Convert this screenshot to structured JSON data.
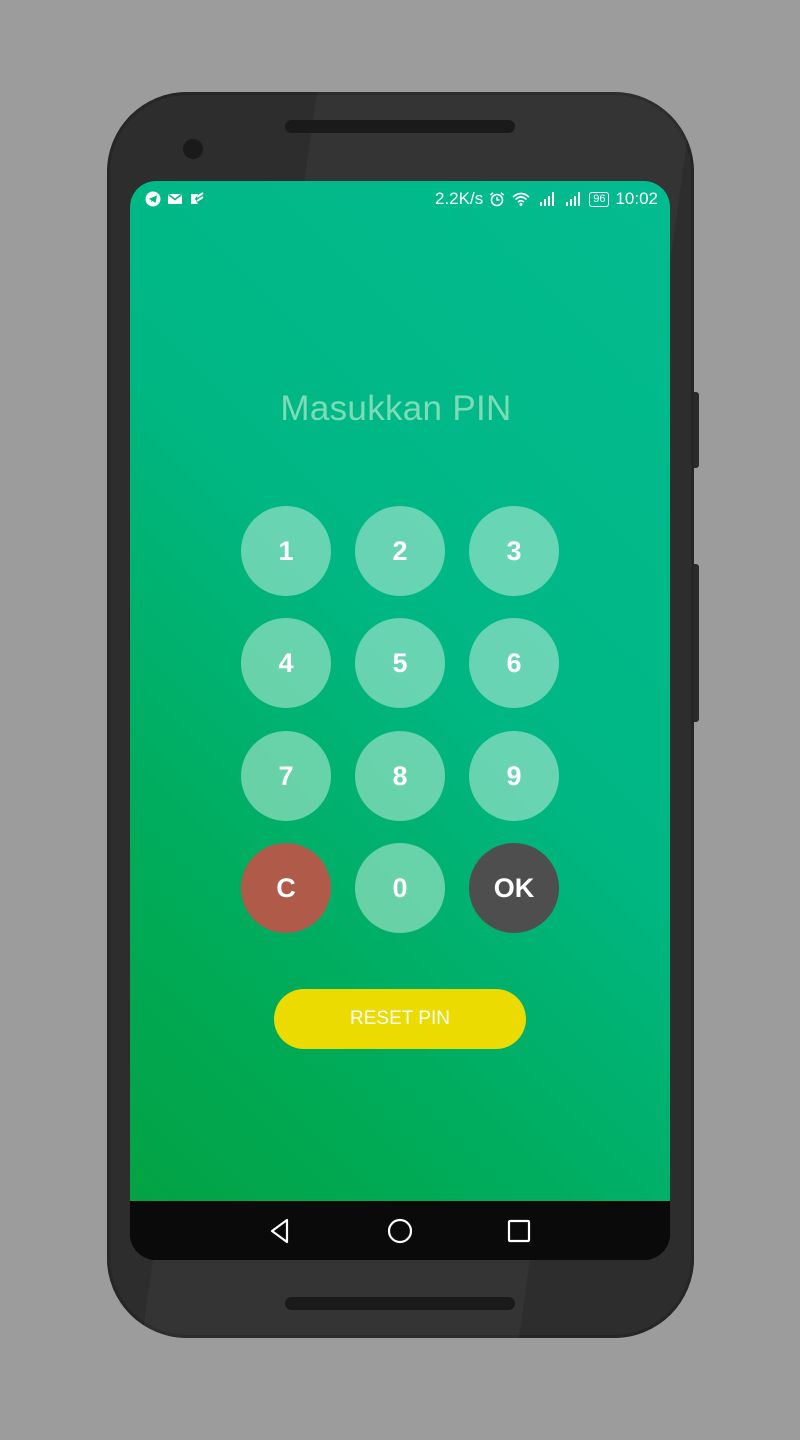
{
  "statusbar": {
    "left_icons": [
      "telegram-icon",
      "gmail-icon",
      "feedly-icon"
    ],
    "speed": "2.2K/s",
    "right_icons": [
      "alarm-icon",
      "wifi-icon",
      "signal-icon",
      "signal-icon"
    ],
    "battery": "96",
    "time": "10:02"
  },
  "pin": {
    "title": "Masukkan PIN",
    "keys": [
      "1",
      "2",
      "3",
      "4",
      "5",
      "6",
      "7",
      "8",
      "9",
      "C",
      "0",
      "OK"
    ],
    "reset_label": "RESET PIN"
  },
  "navbar": {
    "buttons": [
      "back-icon",
      "home-icon",
      "recents-icon"
    ]
  },
  "colors": {
    "gradient_top": "#02bb8f",
    "gradient_bottom": "#03a244",
    "key_bg": "#a6e6cc",
    "clear_key": "#b05a4a",
    "ok_key": "#4e4e4e",
    "reset_button": "#ecdb00"
  }
}
